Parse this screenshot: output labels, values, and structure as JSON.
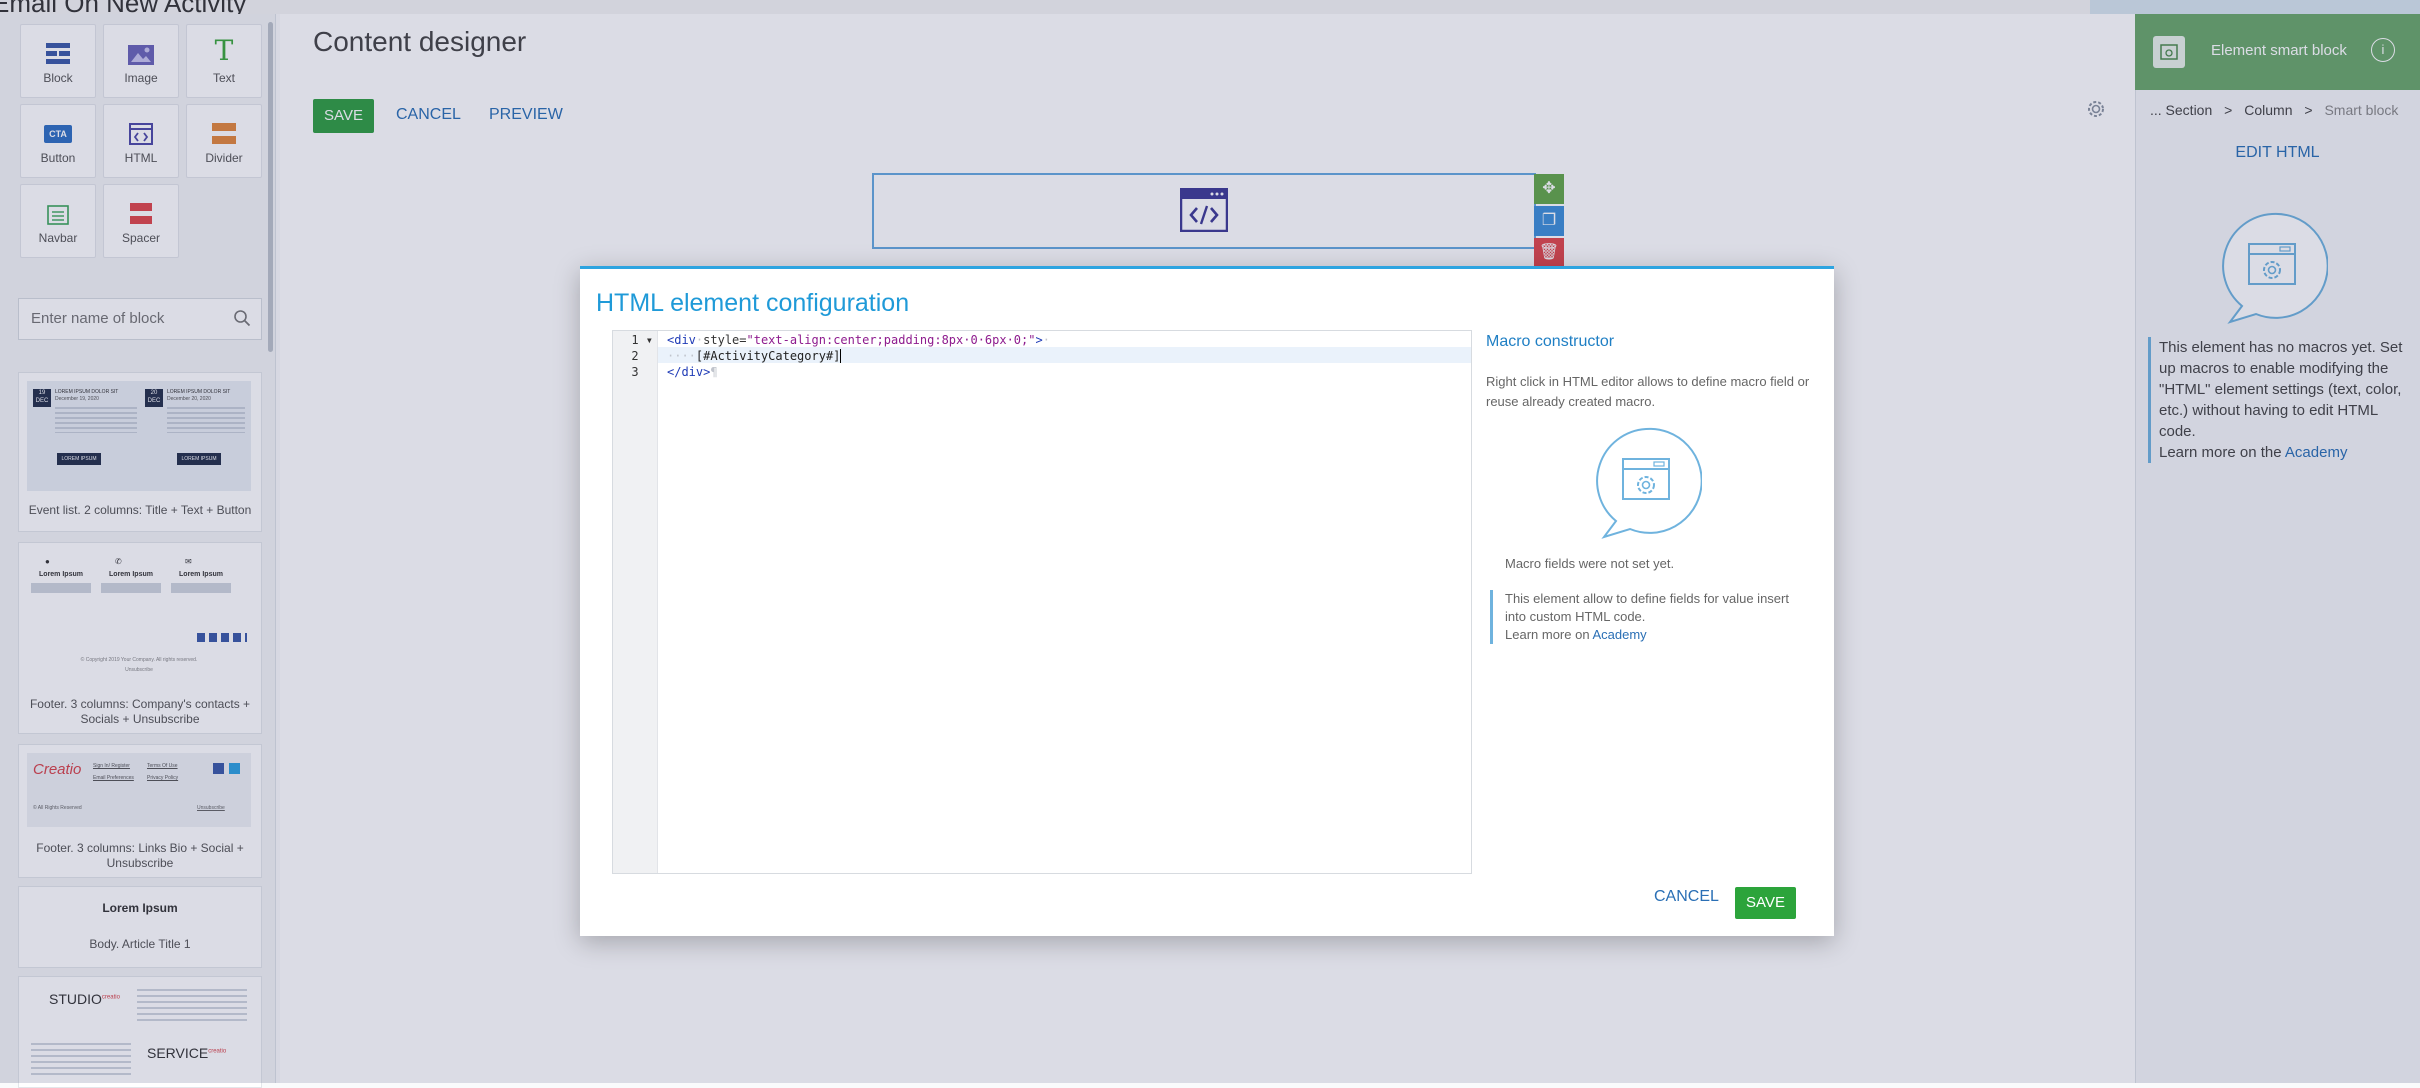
{
  "window": {
    "background_title": "Email On New Activity"
  },
  "palette": {
    "tools": [
      {
        "label": "Block",
        "icon": "block-icon"
      },
      {
        "label": "Image",
        "icon": "image-icon"
      },
      {
        "label": "Text",
        "icon": "text-icon"
      },
      {
        "label": "Button",
        "icon": "cta-button-icon"
      },
      {
        "label": "HTML",
        "icon": "html-icon"
      },
      {
        "label": "Divider",
        "icon": "divider-icon"
      },
      {
        "label": "Navbar",
        "icon": "navbar-icon"
      },
      {
        "label": "Spacer",
        "icon": "spacer-icon"
      }
    ],
    "cta_badge": "CTA",
    "search_placeholder": "Enter name of block",
    "templates": [
      {
        "caption": "Event list. 2 columns: Title + Text + Button",
        "preview": {
          "day1": "19",
          "mon1": "DEC",
          "head1": "LOREM IPSUM DOLOR SIT",
          "date1": "December 19, 2020",
          "day2": "20",
          "mon2": "DEC",
          "head2": "LOREM IPSUM DOLOR SIT",
          "date2": "December 20, 2020",
          "btn": "LOREM IPSUM"
        }
      },
      {
        "caption": "Footer. 3 columns: Company's contacts + Socials + Unsubscribe",
        "preview": {
          "col": "Lorem Ipsum",
          "copyright": "© Copyright 2019 Your Company. All rights reserved.",
          "unsub": "Unsubscribe"
        }
      },
      {
        "caption": "Footer. 3 columns: Links Bio + Social + Unsubscribe",
        "preview": {
          "logo": "Creatio",
          "rights": "© All Rights Reserved",
          "l1": "Sign In/ Register",
          "l2": "Terms Of Use",
          "l3": "Email Preferences",
          "l4": "Privacy Policy",
          "unsub": "Unsubscribe"
        }
      },
      {
        "caption": "Body. Article Title 1",
        "preview": {
          "heading": "Lorem Ipsum"
        }
      },
      {
        "caption": "",
        "preview": {
          "w1": "STUDIO",
          "w2": "SERVICE",
          "sup": "creatio"
        }
      }
    ]
  },
  "designer": {
    "title": "Content designer",
    "save": "SAVE",
    "cancel": "CANCEL",
    "preview": "PREVIEW"
  },
  "right_panel": {
    "header": "Element smart block",
    "breadcrumbs": [
      "... Section",
      "Column",
      "Smart block"
    ],
    "breadcrumb_sep": ">",
    "edit_html": "EDIT HTML",
    "note": "This element has no macros yet. Set up macros to enable modifying the \"HTML\" element settings (text, color, etc.) without having to edit HTML code.",
    "learn_prefix": "Learn more on the",
    "learn_link": "Academy"
  },
  "modal": {
    "title": "HTML element configuration",
    "code": {
      "line1": {
        "num": "1",
        "open": "<div",
        "ws1": "·",
        "attr": "style=",
        "val": "\"text-align:center;padding:8px·0·6px·0;\"",
        "close": ">",
        "ws2": "·"
      },
      "line2": {
        "num": "2",
        "indent": "····",
        "text": "[#ActivityCategory#]"
      },
      "line3": {
        "num": "3",
        "close": "</div>",
        "eol": "¶"
      }
    },
    "macro": {
      "title": "Macro constructor",
      "desc": "Right click in HTML editor allows to define macro field or reuse already created macro.",
      "empty": "Macro fields were not set yet.",
      "note": "This element allow to define fields for value insert into custom HTML code.",
      "learn_prefix": "Learn more on",
      "learn_link": "Academy"
    },
    "cancel": "CANCEL",
    "save": "SAVE"
  },
  "colors": {
    "accent": "#1f9ad8",
    "save_green": "#2ca43b",
    "link_blue": "#2a6fb5"
  }
}
